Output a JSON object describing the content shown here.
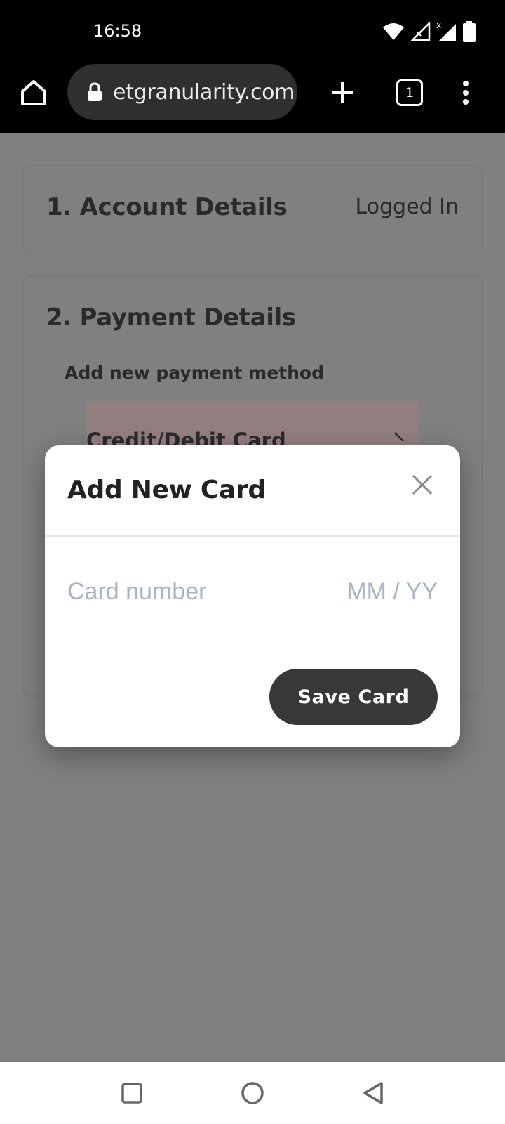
{
  "status_bar": {
    "time": "16:58",
    "icons": [
      "wifi-icon",
      "signal-no-data-icon",
      "signal-icon",
      "battery-icon"
    ]
  },
  "browser": {
    "url": "etgranularity.com",
    "tab_count": "1",
    "icons": [
      "home-icon",
      "lock-icon",
      "plus-icon",
      "tabs-icon",
      "more-vert-icon"
    ]
  },
  "page": {
    "account": {
      "title": "1. Account Details",
      "status": "Logged In"
    },
    "payment": {
      "title": "2. Payment Details",
      "subtitle": "Add new payment method",
      "option_label": "Credit/Debit Card"
    }
  },
  "modal": {
    "title": "Add New Card",
    "card_number_placeholder": "Card number",
    "expiry_placeholder": "MM / YY",
    "save_label": "Save Card"
  },
  "nav_bar": {
    "icons": [
      "recent-apps-icon",
      "home-circle-icon",
      "back-icon"
    ]
  },
  "colors": {
    "overlay": "#808080",
    "button": "#393836",
    "placeholder": "#a9b4c2",
    "payment_option_bg": "#937f7f"
  }
}
